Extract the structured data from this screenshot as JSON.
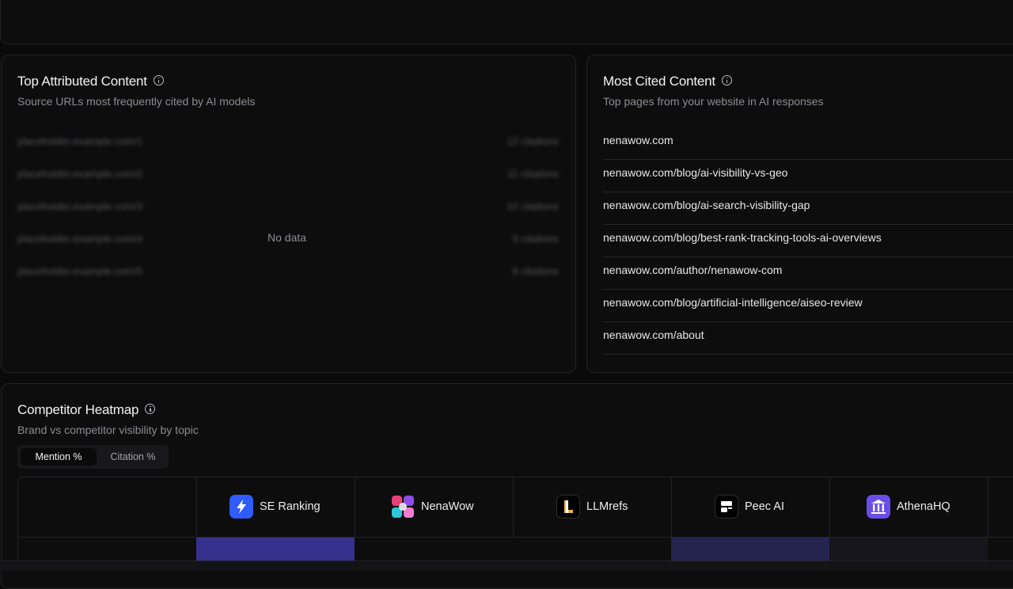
{
  "attributed": {
    "title": "Top Attributed Content",
    "subtitle": "Source URLs most frequently cited by AI models",
    "empty": "No data",
    "placeholder_rows": [
      {
        "left": "placeholder.example.com/1",
        "right": "12 citations"
      },
      {
        "left": "placeholder.example.com/2",
        "right": "11 citations"
      },
      {
        "left": "placeholder.example.com/3",
        "right": "10 citations"
      },
      {
        "left": "placeholder.example.com/4",
        "right": "9 citations"
      },
      {
        "left": "placeholder.example.com/5",
        "right": "8 citations"
      }
    ]
  },
  "cited": {
    "title": "Most Cited Content",
    "subtitle": "Top pages from your website in AI responses",
    "items": [
      "nenawow.com",
      "nenawow.com/blog/ai-visibility-vs-geo",
      "nenawow.com/blog/ai-search-visibility-gap",
      "nenawow.com/blog/best-rank-tracking-tools-ai-overviews",
      "nenawow.com/author/nenawow-com",
      "nenawow.com/blog/artificial-intelligence/aiseo-review",
      "nenawow.com/about"
    ]
  },
  "heatmap": {
    "title": "Competitor Heatmap",
    "subtitle": "Brand vs competitor visibility by topic",
    "toggle": {
      "mention": "Mention %",
      "citation": "Citation %",
      "selected": "Mention %"
    },
    "brands": [
      {
        "name": "SE Ranking",
        "icon": "bolt-icon",
        "color": "#2f5bff"
      },
      {
        "name": "NenaWow",
        "icon": "puzzle-icon",
        "color": "#e9417a"
      },
      {
        "name": "LLMrefs",
        "icon": "letter-l-icon",
        "color": "#f2b233"
      },
      {
        "name": "Peec AI",
        "icon": "peec-icon",
        "color": "#ffffff"
      },
      {
        "name": "AthenaHQ",
        "icon": "pillars-icon",
        "color": "#6a4de8"
      }
    ],
    "first_row_colors": [
      "#35318c",
      "#0d0d0e",
      "#0d0d0e",
      "#25244f",
      "#16161c"
    ]
  }
}
